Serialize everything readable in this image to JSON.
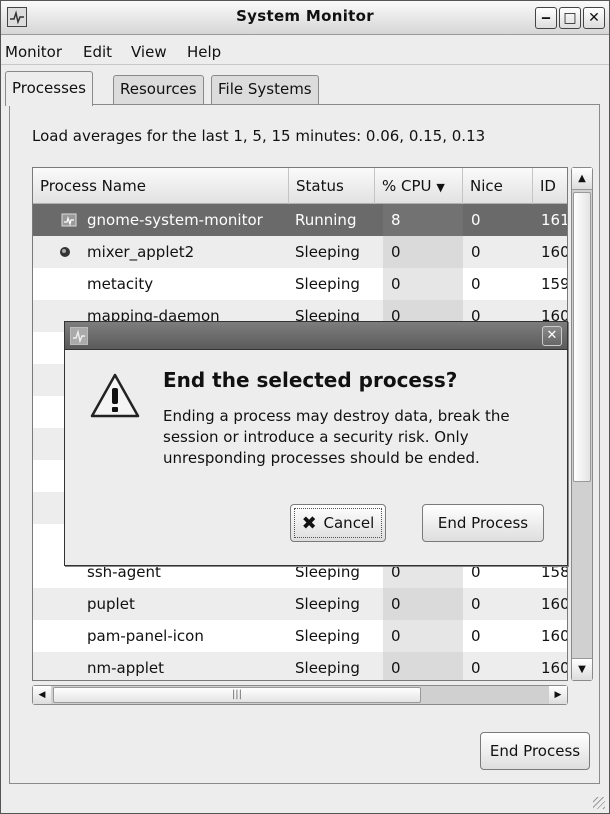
{
  "window": {
    "title": "System Monitor"
  },
  "menubar": [
    "Monitor",
    "Edit",
    "View",
    "Help"
  ],
  "tabs": [
    "Processes",
    "Resources",
    "File Systems"
  ],
  "load_averages": "Load averages for the last 1, 5, 15 minutes: 0.06, 0.15, 0.13",
  "table": {
    "columns": [
      "Process Name",
      "Status",
      "% CPU",
      "Nice",
      "ID"
    ],
    "sort_indicator": "▼",
    "rows": [
      {
        "name": "gnome-system-monitor",
        "status": "Running",
        "cpu": "8",
        "nice": "0",
        "id": "161"
      },
      {
        "name": "mixer_applet2",
        "status": "Sleeping",
        "cpu": "0",
        "nice": "0",
        "id": "160"
      },
      {
        "name": "metacity",
        "status": "Sleeping",
        "cpu": "0",
        "nice": "0",
        "id": "159"
      },
      {
        "name": "mapping-daemon",
        "status": "Sleeping",
        "cpu": "0",
        "nice": "0",
        "id": "160"
      },
      {
        "name": "",
        "status": "",
        "cpu": "",
        "nice": "",
        "id": ""
      },
      {
        "name": "",
        "status": "",
        "cpu": "",
        "nice": "",
        "id": ""
      },
      {
        "name": "",
        "status": "",
        "cpu": "",
        "nice": "",
        "id": ""
      },
      {
        "name": "",
        "status": "",
        "cpu": "",
        "nice": "",
        "id": ""
      },
      {
        "name": "",
        "status": "",
        "cpu": "",
        "nice": "",
        "id": ""
      },
      {
        "name": "",
        "status": "",
        "cpu": "",
        "nice": "",
        "id": ""
      },
      {
        "name": "",
        "status": "",
        "cpu": "",
        "nice": "",
        "id": ""
      },
      {
        "name": "ssh-agent",
        "status": "Sleeping",
        "cpu": "0",
        "nice": "0",
        "id": "158"
      },
      {
        "name": "puplet",
        "status": "Sleeping",
        "cpu": "0",
        "nice": "0",
        "id": "160"
      },
      {
        "name": "pam-panel-icon",
        "status": "Sleeping",
        "cpu": "0",
        "nice": "0",
        "id": "160"
      },
      {
        "name": "nm-applet",
        "status": "Sleeping",
        "cpu": "0",
        "nice": "0",
        "id": "160"
      }
    ]
  },
  "end_process_button": "End Process",
  "dialog": {
    "heading": "End the selected process?",
    "body": "Ending a process may destroy data, break the session or introduce a security risk. Only unresponding processes should be ended.",
    "cancel_label": "Cancel",
    "end_label": "End Process"
  }
}
